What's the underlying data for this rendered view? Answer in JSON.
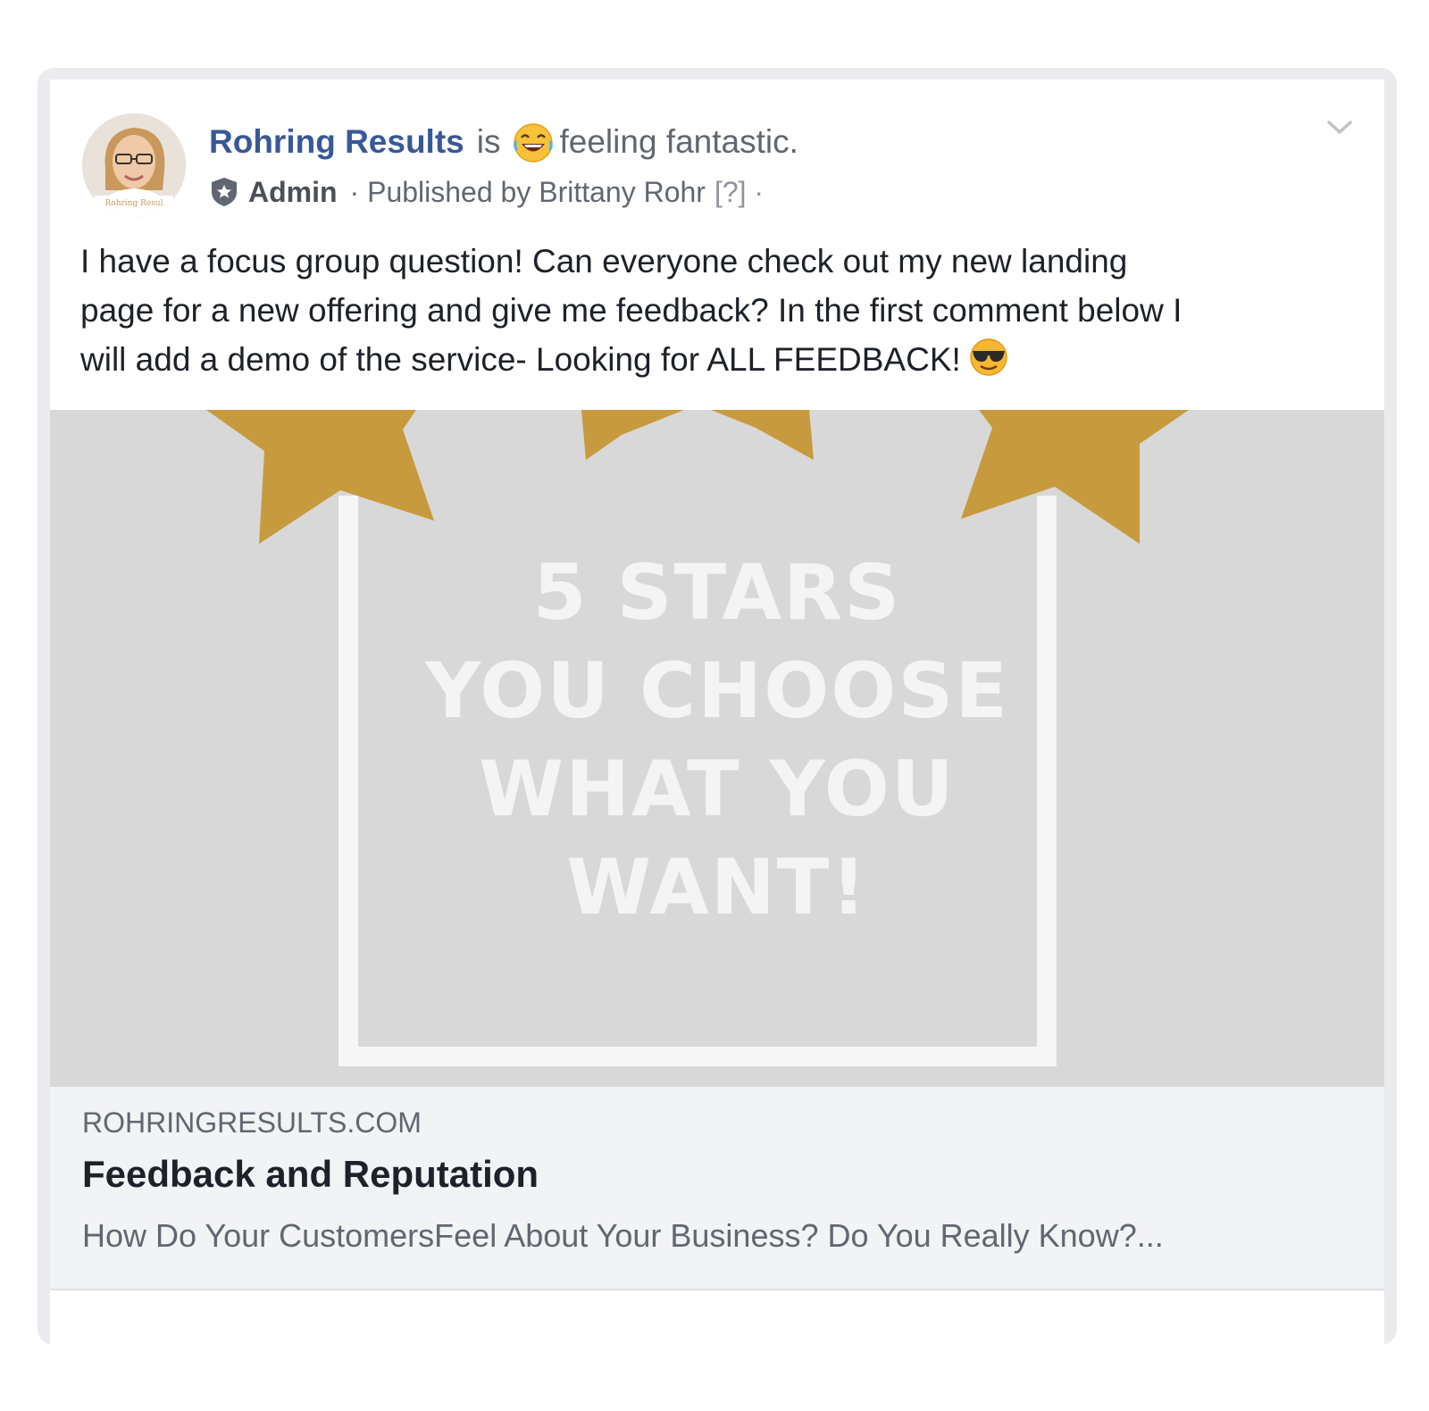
{
  "post": {
    "page_name": "Rohring Results",
    "is_word": "is",
    "feeling_text": "feeling fantastic.",
    "feeling_icon": "laughing-emoji-icon",
    "role": "Admin",
    "published_by": "· Published by Brittany Rohr",
    "help_mark": "[?] ·",
    "text_lines": [
      "I have a focus group question! Can everyone check out my new landing",
      "page for a new offering and give me feedback? In the first comment below I",
      "will add a demo of the service- Looking for ALL FEEDBACK!"
    ],
    "end_icon": "sunglasses-emoji-icon",
    "avatar_caption": "Rohring Resul"
  },
  "link_preview": {
    "image_lines": [
      "5 STARS",
      "YOU CHOOSE",
      "WHAT YOU",
      "WANT!"
    ],
    "domain": "ROHRINGRESULTS.COM",
    "title": "Feedback and Reputation",
    "description": "How Do Your CustomersFeel About Your Business? Do You Really Know?..."
  },
  "colors": {
    "link_blue": "#385898",
    "star_gold": "#c89a3e",
    "image_bg": "#d8d8d8",
    "caption_bg": "#f2f3f5"
  }
}
